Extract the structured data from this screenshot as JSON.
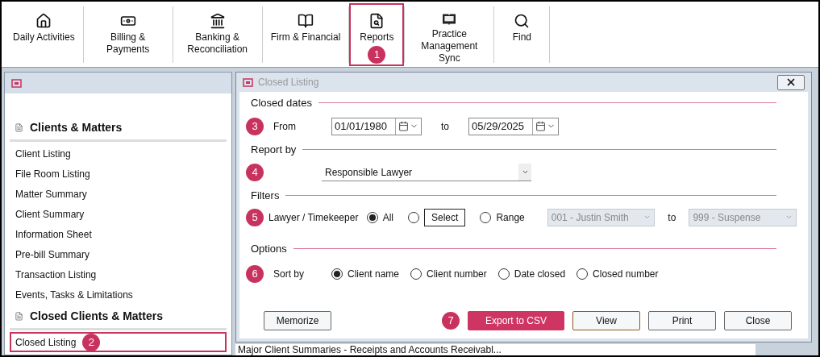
{
  "toolbar": [
    {
      "kind": "home",
      "label": "Daily Activities",
      "selected": false
    },
    {
      "kind": "money",
      "label": "Billing & Payments",
      "selected": false
    },
    {
      "kind": "bank",
      "label": "Banking & Reconciliation",
      "selected": false
    },
    {
      "kind": "book",
      "label": "Firm & Financial",
      "selected": false
    },
    {
      "kind": "report",
      "label": "Reports",
      "selected": true,
      "badge": "1"
    },
    {
      "kind": "sync",
      "label": "Practice Management Sync",
      "selected": false
    },
    {
      "kind": "search",
      "label": "Find",
      "selected": false
    }
  ],
  "sidebar": {
    "sections": [
      {
        "title": "Clients & Matters",
        "items": [
          {
            "label": "Client Listing",
            "selected": false
          },
          {
            "label": "File Room Listing",
            "selected": false
          },
          {
            "label": "Matter Summary",
            "selected": false
          },
          {
            "label": "Client Summary",
            "selected": false
          },
          {
            "label": "Information Sheet",
            "selected": false
          },
          {
            "label": "Pre-bill Summary",
            "selected": false
          },
          {
            "label": "Transaction Listing",
            "selected": false
          },
          {
            "label": "Events, Tasks & Limitations",
            "selected": false
          }
        ]
      },
      {
        "title": "Closed Clients & Matters",
        "items": [
          {
            "label": "Closed Listing",
            "selected": true,
            "badge": "2"
          }
        ]
      }
    ]
  },
  "dialog": {
    "title": "Closed Listing",
    "closed_dates": {
      "heading": "Closed dates",
      "badge": "3",
      "from_label": "From",
      "from_value": "01/01/1980",
      "to_label": "to",
      "to_value": "05/29/2025"
    },
    "report_by": {
      "heading": "Report by",
      "badge": "4",
      "value": "Responsible Lawyer"
    },
    "filters": {
      "heading": "Filters",
      "badge": "5",
      "label": "Lawyer / Timekeeper",
      "options": [
        {
          "label": "All",
          "selected": true,
          "kind": "plain"
        },
        {
          "label": "Select",
          "selected": false,
          "kind": "button"
        },
        {
          "label": "Range",
          "selected": false,
          "kind": "plain"
        }
      ],
      "range_from": "001 - Justin Smith",
      "range_to_label": "to",
      "range_to": "999 - Suspense"
    },
    "options": {
      "heading": "Options",
      "badge": "6",
      "label": "Sort by",
      "sort": [
        {
          "label": "Client name",
          "selected": true
        },
        {
          "label": "Client number",
          "selected": false
        },
        {
          "label": "Date closed",
          "selected": false
        },
        {
          "label": "Closed number",
          "selected": false
        }
      ]
    },
    "buttons": [
      {
        "label": "Memorize",
        "kind": "plain"
      },
      {
        "label": "Export to CSV",
        "kind": "primary",
        "badge": "7"
      },
      {
        "label": "View",
        "kind": "default"
      },
      {
        "label": "Print",
        "kind": "plain"
      },
      {
        "label": "Close",
        "kind": "plain"
      }
    ]
  },
  "status_text": "Major Client Summaries - Receipts and Accounts Receivabl..."
}
